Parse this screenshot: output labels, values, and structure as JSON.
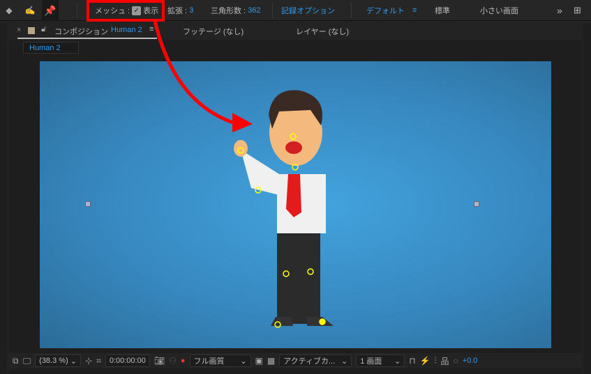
{
  "toolbar": {
    "mesh_label": "メッシュ :",
    "show_label": "表示",
    "expand_label": "拡張 :",
    "expand_value": "3",
    "triangles_label": "三角形数 :",
    "triangles_value": "362",
    "record_options": "記録オプション",
    "workspace_default": "デフォルト",
    "workspace_standard": "標準",
    "workspace_small": "小さい画面",
    "more": "»"
  },
  "tabs": {
    "composition_prefix": "コンポジション",
    "composition_name": "Human 2",
    "footage": "フッテージ (なし)",
    "layer": "レイヤー (なし)"
  },
  "breadcrumb": "Human 2",
  "bottom": {
    "zoom": "(38.3 %)",
    "timecode": "0:00:00:00",
    "resolution": "フル画質",
    "camera": "アクティブカ...",
    "views": "1 画面",
    "exposure": "+0.0"
  },
  "colors": {
    "accent": "#2d9bf0",
    "highlight": "#ff0000"
  }
}
